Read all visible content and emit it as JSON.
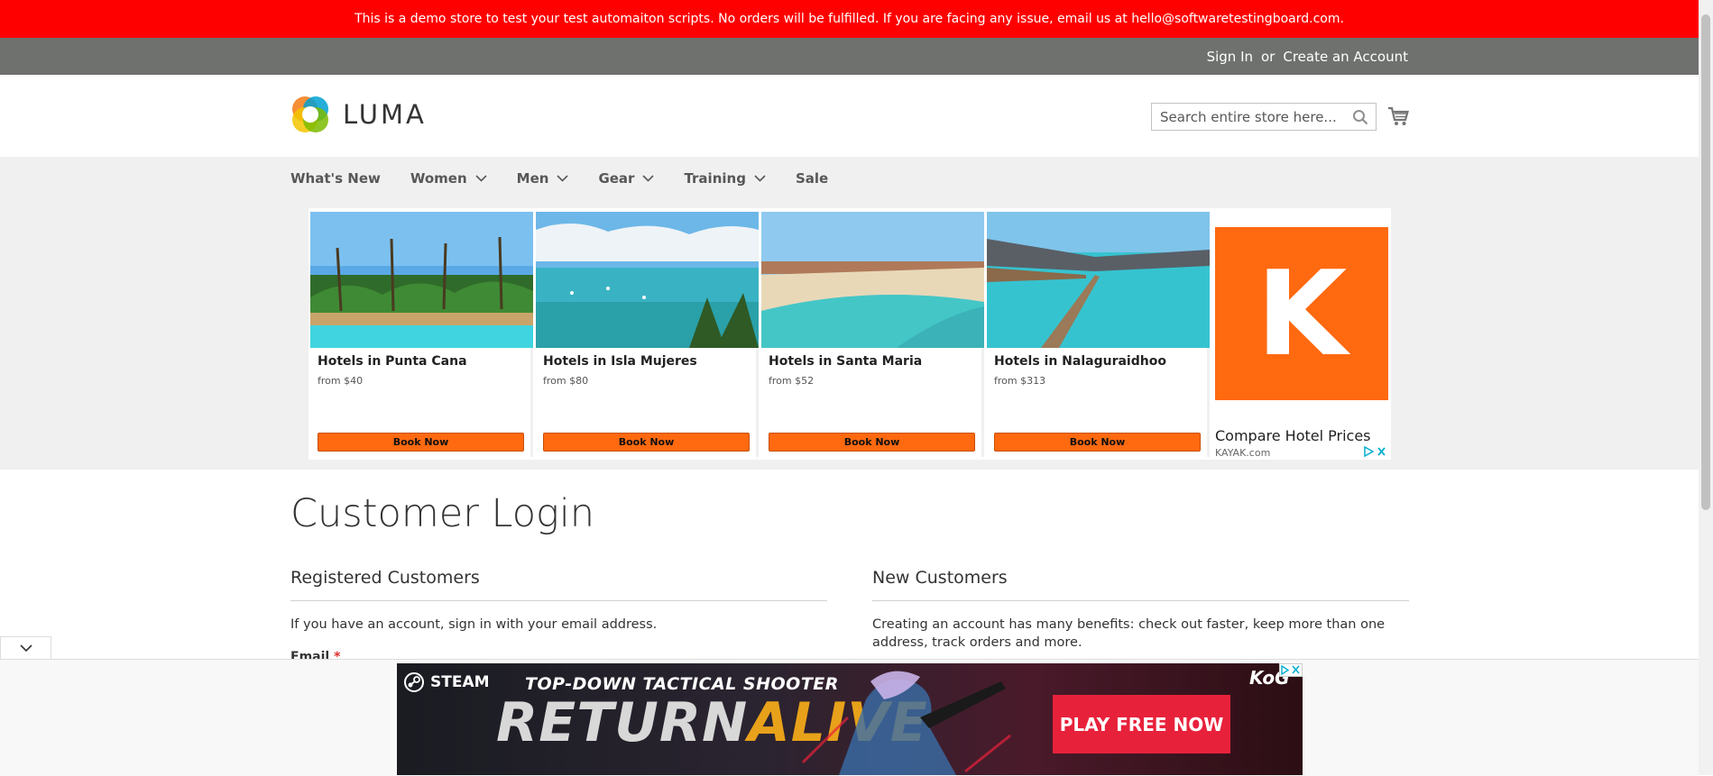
{
  "demo_banner": {
    "text": "This is a demo store to test your test automaiton scripts. No orders will be fulfilled. If you are facing any issue, email us at hello@softwaretestingboard.com."
  },
  "top_links": {
    "sign_in": "Sign In",
    "or": "or",
    "create_account": "Create an Account"
  },
  "header": {
    "logo_text": "LUMA",
    "search_placeholder": "Search entire store here...",
    "search_icon": "search-icon",
    "cart_icon": "cart-icon"
  },
  "nav": {
    "items": [
      {
        "label": "What's New",
        "has_dropdown": false
      },
      {
        "label": "Women",
        "has_dropdown": true
      },
      {
        "label": "Men",
        "has_dropdown": true
      },
      {
        "label": "Gear",
        "has_dropdown": true
      },
      {
        "label": "Training",
        "has_dropdown": true
      },
      {
        "label": "Sale",
        "has_dropdown": false
      }
    ]
  },
  "hotel_ad": {
    "cards": [
      {
        "name": "Hotels in Punta Cana",
        "price": "from $40",
        "button": "Book Now"
      },
      {
        "name": "Hotels in Isla Mujeres",
        "price": "from $80",
        "button": "Book Now"
      },
      {
        "name": "Hotels in Santa Maria",
        "price": "from $52",
        "button": "Book Now"
      },
      {
        "name": "Hotels in Nalaguraidhoo",
        "price": "from $313",
        "button": "Book Now"
      }
    ],
    "sponsor_letter": "K",
    "sponsor_title": "Compare Hotel Prices",
    "sponsor_domain": "KAYAK.com",
    "brand_color": "#ff690f"
  },
  "main": {
    "title": "Customer Login",
    "registered": {
      "heading": "Registered Customers",
      "text": "If you have an account, sign in with your email address.",
      "email_label": "Email",
      "required_mark": "*"
    },
    "new_customers": {
      "heading": "New Customers",
      "text": "Creating an account has many benefits: check out faster, keep more than one address, track orders and more."
    }
  },
  "bottom_ad": {
    "brand": "STEAM",
    "tagline": "TOP-DOWN TACTICAL SHOOTER",
    "game_part1": "RETURN",
    "game_part2": "ALIVE",
    "cta": "PLAY FREE NOW",
    "corner_logo": "KoG"
  },
  "colors": {
    "demo_banner_bg": "#ff0000",
    "top_bar_bg": "#6e716e",
    "nav_bg": "#f0f0f0",
    "cta_red": "#e8213b",
    "required": "#e02b27"
  }
}
